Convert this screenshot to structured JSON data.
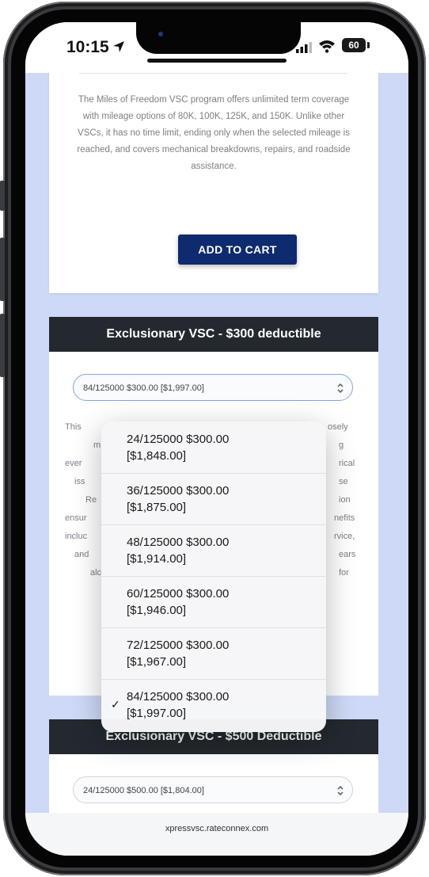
{
  "status_bar": {
    "time": "10:15",
    "battery": "60"
  },
  "card1": {
    "description": "The Miles of Freedom VSC program offers unlimited term coverage with mileage options of 80K, 100K, 125K, and 150K. Unlike other VSCs, it has no time limit, ending only when the selected mileage is reached, and covers mechanical breakdowns, repairs, and roadside assistance.",
    "add_to_cart": "ADD TO CART"
  },
  "card2": {
    "title": "Exclusionary VSC - $300 deductible",
    "selected": "84/125000 $300.00 [$1,997.00]",
    "description_fragments": [
      "This",
      "osely",
      "m",
      "g",
      "ever",
      "rical",
      "iss",
      "se",
      "Re",
      "ion",
      "ensur",
      "nefits",
      "incluc",
      "rvice,",
      "and",
      "ears",
      "alc",
      "for"
    ]
  },
  "dropdown": {
    "options": [
      {
        "line1": "24/125000 $300.00",
        "line2": "[$1,848.00]"
      },
      {
        "line1": "36/125000 $300.00",
        "line2": "[$1,875.00]"
      },
      {
        "line1": "48/125000 $300.00",
        "line2": "[$1,914.00]"
      },
      {
        "line1": "60/125000 $300.00",
        "line2": "[$1,946.00]"
      },
      {
        "line1": "72/125000 $300.00",
        "line2": "[$1,967.00]"
      },
      {
        "line1": "84/125000 $300.00",
        "line2": "[$1,997.00]",
        "checked": true
      }
    ],
    "check_glyph": "✓"
  },
  "card3": {
    "title": "Exclusionary VSC - $500 Deductible",
    "selected": "24/125000 $500.00 [$1,804.00]"
  },
  "browser": {
    "url": "xpressvsc.rateconnex.com"
  }
}
